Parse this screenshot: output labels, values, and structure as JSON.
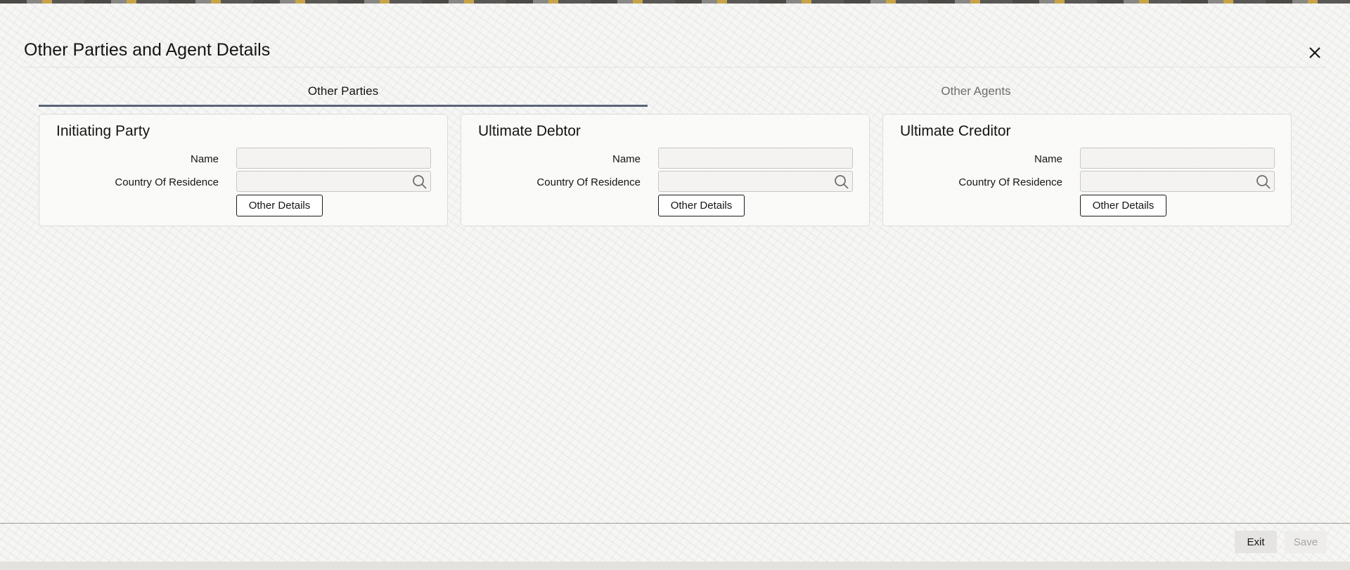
{
  "dialog": {
    "title": "Other Parties and Agent Details",
    "close_icon": "close-icon"
  },
  "tabs": [
    {
      "label": "Other Parties",
      "active": true
    },
    {
      "label": "Other Agents",
      "active": false
    }
  ],
  "panels": [
    {
      "heading": "Initiating Party",
      "name_label": "Name",
      "name_value": "",
      "country_label": "Country Of Residence",
      "country_value": "",
      "button_label": "Other Details"
    },
    {
      "heading": "Ultimate Debtor",
      "name_label": "Name",
      "name_value": "",
      "country_label": "Country Of Residence",
      "country_value": "",
      "button_label": "Other Details"
    },
    {
      "heading": "Ultimate Creditor",
      "name_label": "Name",
      "name_value": "",
      "country_label": "Country Of Residence",
      "country_value": "",
      "button_label": "Other Details"
    }
  ],
  "footer": {
    "exit_label": "Exit",
    "save_label": "Save",
    "save_enabled": false
  },
  "colors": {
    "active_tab_underline": "#5a6378",
    "inactive_tab_text": "#6f6e6b",
    "disabled_button_text": "#a8a6a2"
  }
}
